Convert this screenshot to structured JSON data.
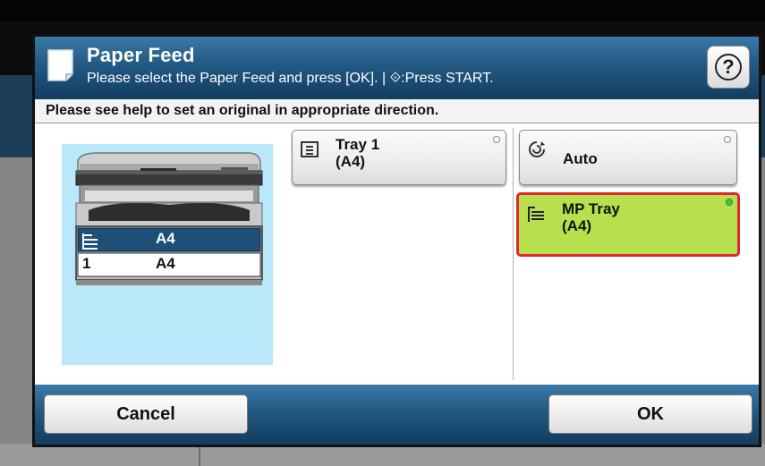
{
  "dialog": {
    "title": "Paper Feed",
    "subtitle": "Please select the Paper Feed and press [OK]. | ⟐:Press START.",
    "help_icon": "question-circle-icon",
    "info_text": "Please see help to set an original in appropriate direction."
  },
  "preview": {
    "mp_tray_size": "A4",
    "tray1_number": "1",
    "tray1_size": "A4"
  },
  "options": {
    "tray1": {
      "label_line1": "Tray 1",
      "label_line2": "(A4)",
      "icon": "tray-icon"
    },
    "auto": {
      "label_line1": "Auto",
      "icon": "auto-select-icon"
    },
    "mp_tray": {
      "label_line1": "MP Tray",
      "label_line2": "(A4)",
      "icon": "mp-tray-icon",
      "selected": true
    }
  },
  "footer": {
    "cancel_label": "Cancel",
    "ok_label": "OK"
  },
  "colors": {
    "titlebar": "#225983",
    "selected_fill": "#b6e04e",
    "selected_border": "#e2262f",
    "preview_bg": "#b9e8fb",
    "highlight_row": "#1e4f77"
  }
}
